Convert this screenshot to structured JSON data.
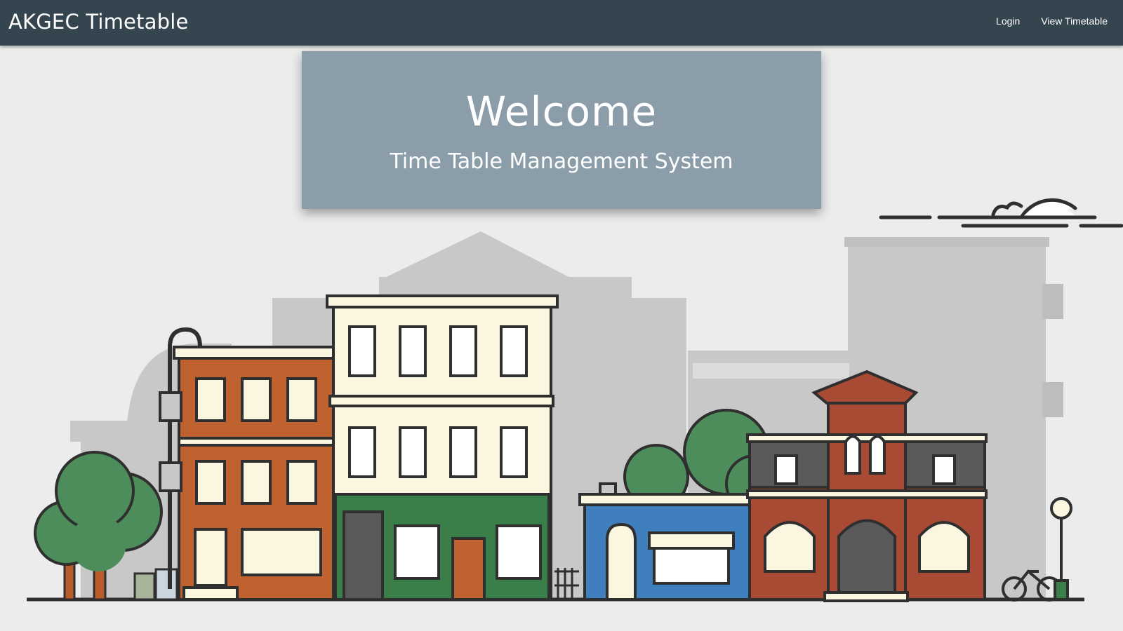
{
  "navbar": {
    "brand": "AKGEC Timetable",
    "links": [
      {
        "label": "Login"
      },
      {
        "label": "View Timetable"
      }
    ]
  },
  "hero": {
    "title": "Welcome",
    "subtitle": "Time Table Management System"
  },
  "illustration": {
    "subject": "street-of-buildings-illustration",
    "colors": {
      "background": "#ececec",
      "silhouette": "#c9c9c9",
      "brick_orange": "#c0622f",
      "brick_red": "#a94a34",
      "cream": "#fbf6df",
      "green": "#3a7f4a",
      "tree_green": "#4d8d5b",
      "blue": "#3f7fbe",
      "outline": "#2f2f2f"
    }
  }
}
